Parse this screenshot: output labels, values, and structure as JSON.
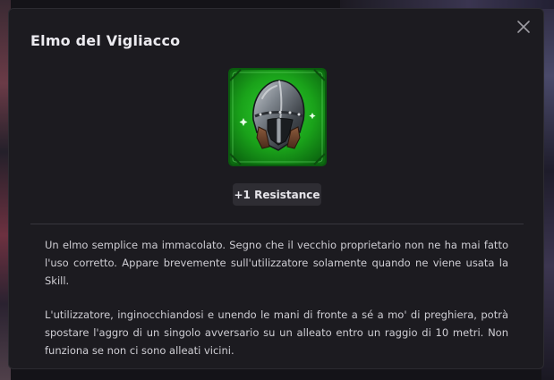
{
  "item": {
    "name": "Elmo del Vigliacco",
    "stat_badge": "+1 Resistance",
    "icon": "knight-helmet-icon",
    "icon_background": "#1fa81f",
    "description": [
      "Un elmo semplice ma immacolato. Segno che il vecchio proprietario non ne ha mai fatto l'uso corretto. Appare brevemente sull'utilizzatore solamente quando ne viene usata la Skill.",
      "L'utilizzatore, inginocchiandosi e unendo le mani di fronte a sé a mo' di preghiera, potrà spostare l'aggro di un singolo avversario su un alleato entro un raggio di 10 metri. Non funziona se non ci sono alleati vicini."
    ]
  },
  "controls": {
    "close_icon": "close-icon"
  },
  "colors": {
    "modal_background": "#1c1b20",
    "badge_background": "#2e2d33",
    "text": "#cfced4"
  }
}
